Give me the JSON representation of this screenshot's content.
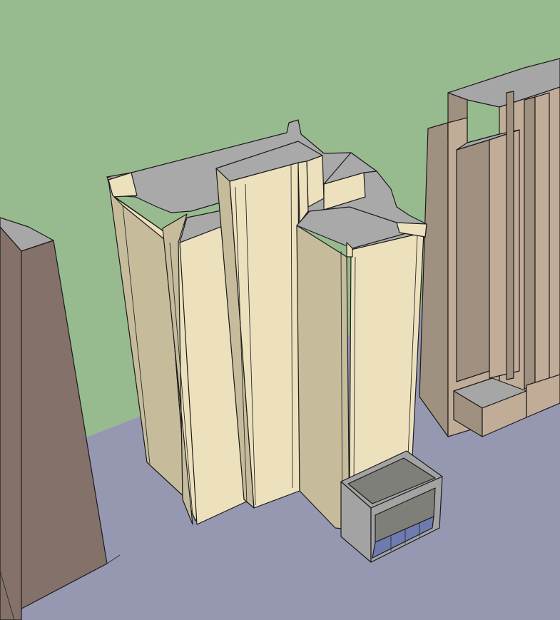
{
  "scene": {
    "sky_color": "#97bb8e",
    "ground_color": "#9698b2",
    "main_tower": {
      "front_color": "#ede1bd",
      "side_color": "#c6bc9c",
      "roof_color": "#a9a9a9"
    },
    "right_tower": {
      "front_color": "#c1ac98",
      "side_color": "#a0907f",
      "roof_color": "#a6a6a6"
    },
    "left_tower": {
      "front_color": "#847169",
      "roof_color": "#a7a7a7"
    },
    "entrance_canopy": {
      "frame_color": "#a3a3a3",
      "inner_color": "#7f7f7a",
      "glass_color": "#6f7bb0"
    }
  }
}
